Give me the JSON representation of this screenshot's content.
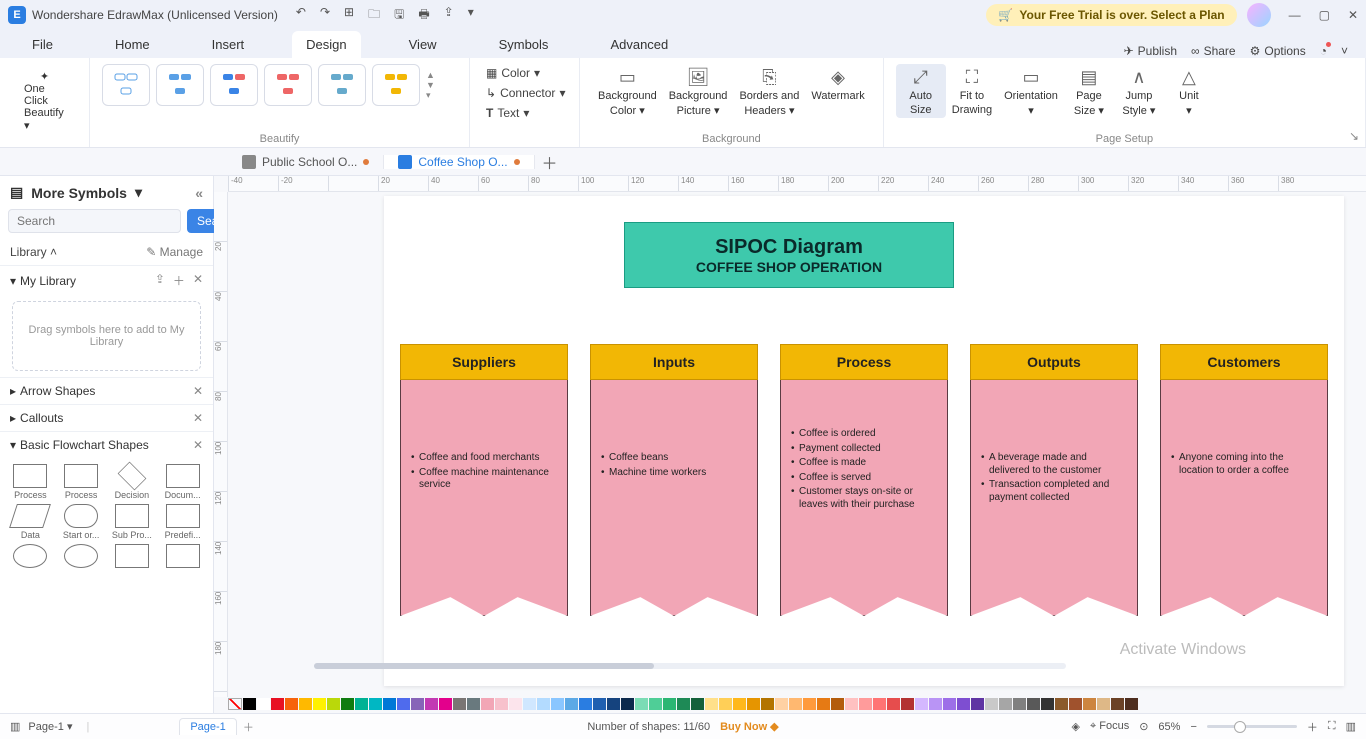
{
  "titlebar": {
    "app_title": "Wondershare EdrawMax (Unlicensed Version)",
    "trial_text": "Your Free Trial is over. Select a Plan"
  },
  "menu": {
    "items": [
      "File",
      "Home",
      "Insert",
      "Design",
      "View",
      "Symbols",
      "Advanced"
    ],
    "active_index": 3,
    "right": {
      "publish": "Publish",
      "share": "Share",
      "options": "Options"
    }
  },
  "ribbon": {
    "oneclick": {
      "l1": "One Click",
      "l2": "Beautify"
    },
    "group_beautify": "Beautify",
    "color": "Color",
    "connector": "Connector",
    "text": "Text",
    "bg_color": {
      "l1": "Background",
      "l2": "Color"
    },
    "bg_pic": {
      "l1": "Background",
      "l2": "Picture"
    },
    "borders": {
      "l1": "Borders and",
      "l2": "Headers"
    },
    "watermark": "Watermark",
    "group_background": "Background",
    "autosize": {
      "l1": "Auto",
      "l2": "Size"
    },
    "fit": {
      "l1": "Fit to",
      "l2": "Drawing"
    },
    "orientation": "Orientation",
    "pagesize": {
      "l1": "Page",
      "l2": "Size"
    },
    "jumpstyle": {
      "l1": "Jump",
      "l2": "Style"
    },
    "unit": "Unit",
    "group_pagesetup": "Page Setup"
  },
  "doctabs": {
    "tabs": [
      {
        "label": "Public School O...",
        "active": false
      },
      {
        "label": "Coffee Shop O...",
        "active": true
      }
    ]
  },
  "sidebar": {
    "head": "More Symbols",
    "search_placeholder": "Search",
    "search_btn": "Search",
    "library": "Library",
    "manage": "Manage",
    "mylib": "My Library",
    "drop": "Drag symbols here to add to My Library",
    "sections": [
      "Arrow Shapes",
      "Callouts",
      "Basic Flowchart Shapes"
    ],
    "shapes": [
      "Process",
      "Process",
      "Decision",
      "Docum...",
      "Data",
      "Start or...",
      "Sub Pro...",
      "Predefi..."
    ]
  },
  "ruler_h": [
    "-40",
    "-20",
    "",
    "20",
    "40",
    "60",
    "80",
    "100",
    "120",
    "140",
    "160",
    "180",
    "200",
    "220",
    "240",
    "260",
    "280",
    "300",
    "320",
    "340",
    "360",
    "380"
  ],
  "ruler_v": [
    "",
    "20",
    "40",
    "60",
    "80",
    "100",
    "120",
    "140",
    "160",
    "180"
  ],
  "sipoc": {
    "title": "SIPOC Diagram",
    "subtitle": "COFFEE SHOP OPERATION",
    "columns": [
      {
        "head": "Suppliers",
        "items": [
          "Coffee and food merchants",
          "Coffee machine maintenance service"
        ]
      },
      {
        "head": "Inputs",
        "items": [
          "Coffee beans",
          "Machine time workers"
        ]
      },
      {
        "head": "Process",
        "items": [
          "Coffee is ordered",
          "Payment collected",
          "Coffee is made",
          "Coffee is served",
          "Customer stays on-site or leaves with their purchase"
        ]
      },
      {
        "head": "Outputs",
        "items": [
          "A beverage made and delivered to the customer",
          "Transaction completed and payment collected"
        ]
      },
      {
        "head": "Customers",
        "items": [
          "Anyone coming into the location to order a coffee"
        ]
      }
    ]
  },
  "colorbar": [
    "#000",
    "#fff",
    "#e81123",
    "#f7630c",
    "#ffb900",
    "#fff100",
    "#bad80a",
    "#107c10",
    "#00b294",
    "#00b7c3",
    "#0078d7",
    "#4f6bed",
    "#8764b8",
    "#c239b3",
    "#e3008c",
    "#7a7574",
    "#69797e",
    "#f2a6b6",
    "#f7c1cc",
    "#fce4ec",
    "#d0e7ff",
    "#b3dbff",
    "#8ac6ff",
    "#5ca9e6",
    "#2a7de1",
    "#1f5fb0",
    "#15437e",
    "#0c2a4d",
    "#7bdcb5",
    "#4fce97",
    "#2bb673",
    "#1e8a56",
    "#14613b",
    "#ffe08a",
    "#ffcf57",
    "#ffb81c",
    "#e69500",
    "#b37400",
    "#ffd1a3",
    "#ffb870",
    "#ff9a3c",
    "#e67a14",
    "#b35c0c",
    "#ffc1c1",
    "#ff9b9b",
    "#ff7474",
    "#e64d4d",
    "#b33232",
    "#d4b8ff",
    "#b994f5",
    "#9d6fe8",
    "#7e4ed1",
    "#5f34a3",
    "#c9c9c9",
    "#a6a6a6",
    "#808080",
    "#595959",
    "#333333",
    "#8b5a2b",
    "#a0522d",
    "#cd853f",
    "#deb887",
    "#6b4226",
    "#4e2e1f"
  ],
  "status": {
    "page_label": "Page-1",
    "page_tab": "Page-1",
    "shapes": "Number of shapes: 11/60",
    "buy": "Buy Now",
    "focus": "Focus",
    "zoom": "65%"
  },
  "watermark_text": "Activate Windows",
  "chart_data": {
    "type": "table",
    "title": "SIPOC Diagram — COFFEE SHOP OPERATION",
    "columns": [
      "Suppliers",
      "Inputs",
      "Process",
      "Outputs",
      "Customers"
    ],
    "rows": [
      [
        "Coffee and food merchants",
        "Coffee beans",
        "Coffee is ordered",
        "A beverage made and delivered to the customer",
        "Anyone coming into the location to order a coffee"
      ],
      [
        "Coffee machine maintenance service",
        "Machine time workers",
        "Payment collected",
        "Transaction completed and payment collected",
        ""
      ],
      [
        "",
        "",
        "Coffee is made",
        "",
        ""
      ],
      [
        "",
        "",
        "Coffee is served",
        "",
        ""
      ],
      [
        "",
        "",
        "Customer stays on-site or leaves with their purchase",
        "",
        ""
      ]
    ]
  }
}
